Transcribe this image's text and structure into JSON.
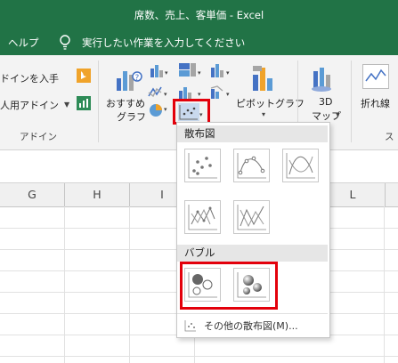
{
  "window": {
    "title": "席数、売上、客単価  -  Excel"
  },
  "tellbar": {
    "help_label": "ヘルプ",
    "tell_me_text": "実行したい作業を入力してください"
  },
  "ribbon": {
    "addin_store_label": "ドインを入手",
    "my_addins_label": "人用アドイン",
    "addins_group_label": "アドイン",
    "recommended_charts_line1": "おすすめ",
    "recommended_charts_line2": "グラフ",
    "pivot_chart_label": "ピボットグラフ",
    "map3d_line1": "3D",
    "map3d_line2": "マップ",
    "sparkline_line_label": "折れ線",
    "sparkline_group_partial": "ス"
  },
  "columns": [
    "G",
    "H",
    "I",
    "L"
  ],
  "dropdown": {
    "scatter_section_label": "散布図",
    "bubble_section_label": "バブル",
    "more_scatter_label": "その他の散布図(M)..."
  },
  "colors": {
    "excel_green": "#217346",
    "highlight_red": "#e3000b",
    "ribbon_bg": "#f3f3f3"
  }
}
